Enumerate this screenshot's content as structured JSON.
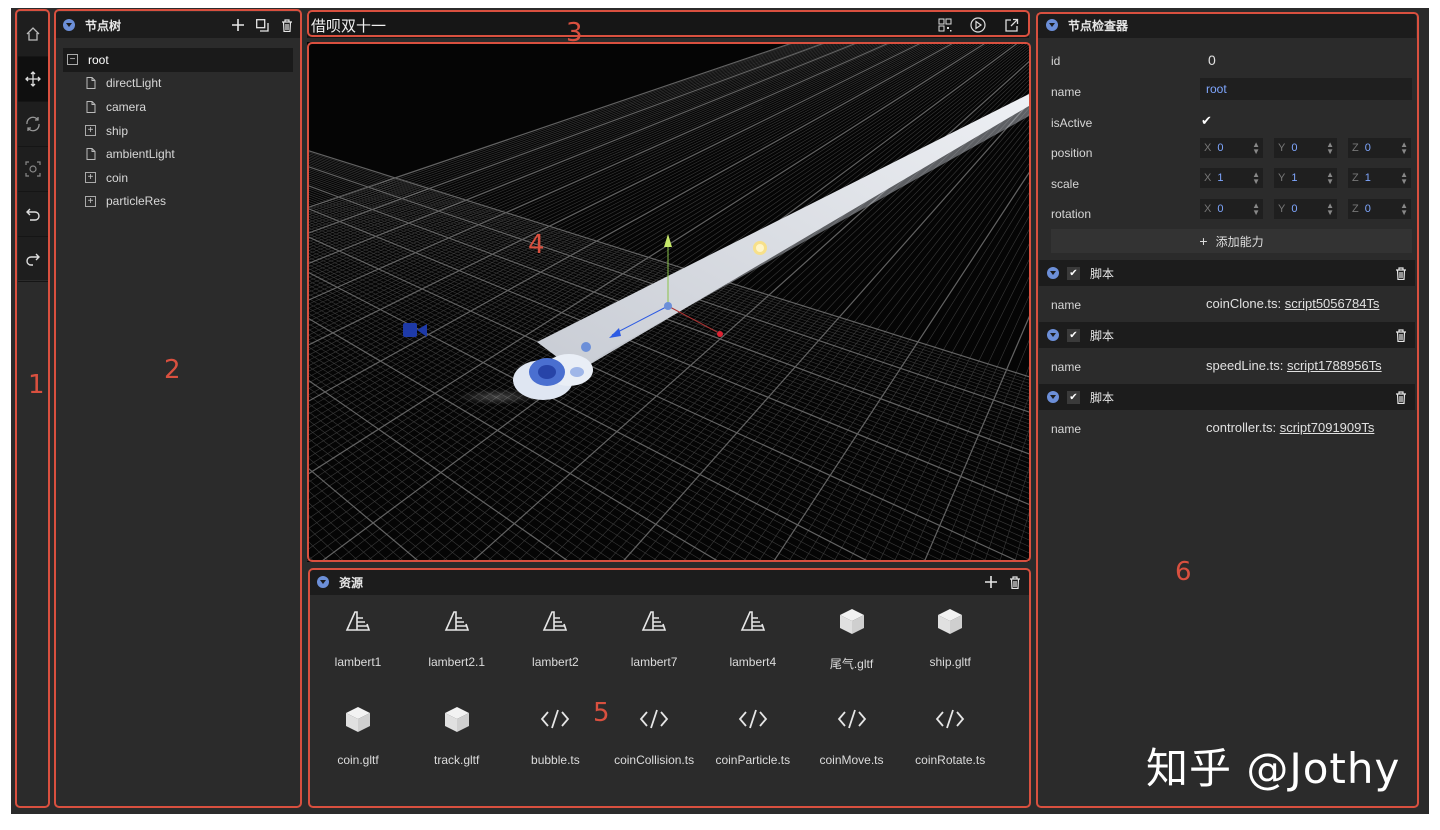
{
  "toolbar": {
    "icons": [
      "home-icon",
      "move-icon",
      "rotate-icon",
      "focus-icon",
      "undo-icon",
      "redo-icon"
    ]
  },
  "node_tree": {
    "title": "节点树",
    "root": "root",
    "children": [
      {
        "label": "directLight",
        "type": "leaf"
      },
      {
        "label": "camera",
        "type": "leaf"
      },
      {
        "label": "ship",
        "type": "expand"
      },
      {
        "label": "ambientLight",
        "type": "leaf"
      },
      {
        "label": "coin",
        "type": "expand"
      },
      {
        "label": "particleRes",
        "type": "expand"
      }
    ]
  },
  "viewport": {
    "title": "借呗双十一"
  },
  "assets": {
    "title": "资源",
    "items": [
      {
        "label": "lambert1",
        "icon": "material-icon"
      },
      {
        "label": "lambert2.1",
        "icon": "material-icon"
      },
      {
        "label": "lambert2",
        "icon": "material-icon"
      },
      {
        "label": "lambert7",
        "icon": "material-icon"
      },
      {
        "label": "lambert4",
        "icon": "material-icon"
      },
      {
        "label": "尾气.gltf",
        "icon": "model-icon"
      },
      {
        "label": "ship.gltf",
        "icon": "model-icon"
      },
      {
        "label": "coin.gltf",
        "icon": "model-icon"
      },
      {
        "label": "track.gltf",
        "icon": "model-icon"
      },
      {
        "label": "bubble.ts",
        "icon": "code-icon"
      },
      {
        "label": "coinCollision.ts",
        "icon": "code-icon"
      },
      {
        "label": "coinParticle.ts",
        "icon": "code-icon"
      },
      {
        "label": "coinMove.ts",
        "icon": "code-icon"
      },
      {
        "label": "coinRotate.ts",
        "icon": "code-icon"
      }
    ]
  },
  "inspector": {
    "title": "节点检查器",
    "id_label": "id",
    "id_value": "0",
    "name_label": "name",
    "name_value": "root",
    "active_label": "isActive",
    "position_label": "position",
    "scale_label": "scale",
    "rotation_label": "rotation",
    "position": {
      "x": "0",
      "y": "0",
      "z": "0"
    },
    "scale": {
      "x": "1",
      "y": "1",
      "z": "1"
    },
    "rotation": {
      "x": "0",
      "y": "0",
      "z": "0"
    },
    "axis": {
      "x": "X",
      "y": "Y",
      "z": "Z"
    },
    "add_label": "添加能力",
    "scripts": [
      {
        "header": "脚本",
        "label": "name",
        "file": "coinClone.ts: ",
        "link": "script5056784Ts"
      },
      {
        "header": "脚本",
        "label": "name",
        "file": "speedLine.ts: ",
        "link": "script1788956Ts"
      },
      {
        "header": "脚本",
        "label": "name",
        "file": "controller.ts: ",
        "link": "script7091909Ts"
      }
    ]
  },
  "annotations": [
    "1",
    "2",
    "3",
    "4",
    "5",
    "6"
  ],
  "watermark": "知乎 @Jothy",
  "colors": {
    "annotation": "#d9503f",
    "accent": "#6c8fd8",
    "value": "#7fa7ff"
  }
}
